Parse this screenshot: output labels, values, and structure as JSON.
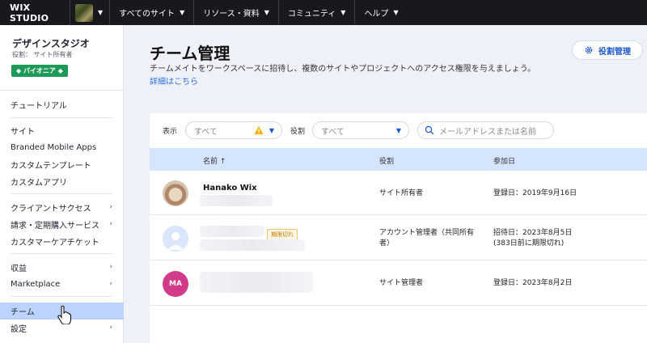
{
  "topbar": {
    "logo": "WIX STUDIO",
    "menu": [
      "すべてのサイト",
      "リソース・資料",
      "コミュニティ",
      "ヘルプ"
    ]
  },
  "sidebar": {
    "studio_name": "デザインスタジオ",
    "role": "役割： サイト所有者",
    "badge": "◆ パイオニア ◆",
    "items": [
      {
        "label": "チュートリアル",
        "arrow": false
      },
      {
        "label": "サイト",
        "arrow": false
      },
      {
        "label": "Branded Mobile Apps",
        "arrow": false
      },
      {
        "label": "カスタムテンプレート",
        "arrow": false
      },
      {
        "label": "カスタムアプリ",
        "arrow": false
      },
      {
        "label": "クライアントサクセス",
        "arrow": true
      },
      {
        "label": "請求・定期購入サービス",
        "arrow": true
      },
      {
        "label": "カスタマーケアチケット",
        "arrow": false
      },
      {
        "label": "収益",
        "arrow": true
      },
      {
        "label": "Marketplace",
        "arrow": true
      },
      {
        "label": "チーム",
        "arrow": false
      },
      {
        "label": "設定",
        "arrow": true
      }
    ]
  },
  "main": {
    "title": "チーム管理",
    "description": "チームメイトをワークスペースに招待し、複数のサイトやプロジェクトへのアクセス権限を与えましょう。",
    "learn_more": "詳細はこちら",
    "roles_button": "役割管理"
  },
  "filters": {
    "show_label": "表示",
    "show_value": "すべて",
    "role_label": "役割",
    "role_value": "すべて",
    "search_placeholder": "メールアドレスまたは名前"
  },
  "table": {
    "headers": {
      "name": "名前 ↑",
      "role": "役割",
      "joined": "参加日"
    },
    "rows": [
      {
        "name": "Hanako Wix",
        "role": "サイト所有者",
        "joined": "登録日：2019年9月16日",
        "joined2": ""
      },
      {
        "name": "",
        "status": "期限切れ",
        "role": "アカウント管理者（共同所有",
        "role2": "者）",
        "joined": "招待日：2023年8月5日",
        "joined2": "(383日前に期限切れ)"
      },
      {
        "name": "",
        "initials": "MA",
        "role": "サイト管理者",
        "joined": "登録日：2023年8月2日",
        "joined2": ""
      }
    ]
  },
  "colors": {
    "accent": "#2e6ee3",
    "active_item": "#bcd3fd",
    "table_header": "#d6e5ff",
    "badge": "#1d9a57",
    "avatar_ma": "#d13b8a"
  }
}
